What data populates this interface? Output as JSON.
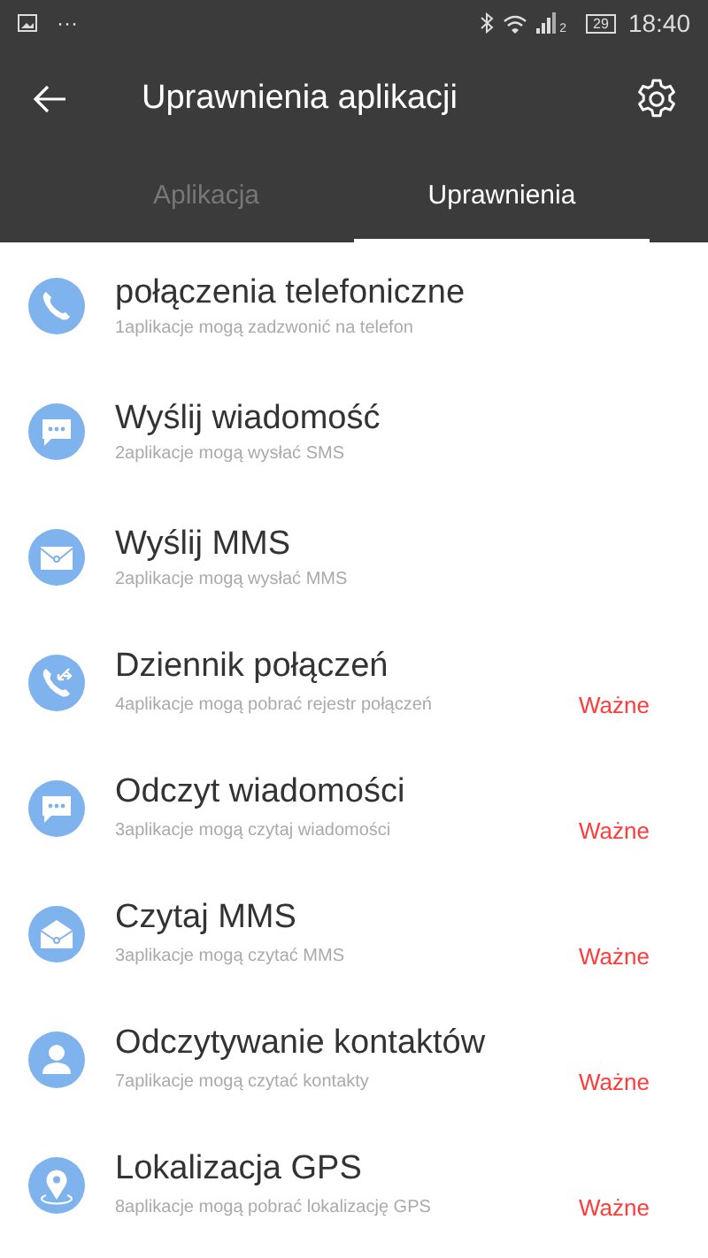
{
  "status_bar": {
    "dots": "···",
    "signal_sim": "2",
    "battery": "29",
    "time": "18:40"
  },
  "header": {
    "title": "Uprawnienia aplikacji"
  },
  "tabs": [
    {
      "label": "Aplikacja",
      "selected": false
    },
    {
      "label": "Uprawnienia",
      "selected": true
    }
  ],
  "permissions": [
    {
      "kind": "phone",
      "title": "połączenia telefoniczne",
      "subtitle": "1aplikacje mogą zadzwonić na telefon"
    },
    {
      "kind": "message",
      "title": "Wyślij wiadomość",
      "subtitle": "2aplikacje mogą wysłać SMS"
    },
    {
      "kind": "envelope",
      "title": "Wyślij MMS",
      "subtitle": "2aplikacje mogą wysłać MMS"
    },
    {
      "kind": "calllog",
      "title": "Dziennik połączeń",
      "subtitle": "4aplikacje mogą pobrać rejestr połączeń",
      "badge": "Ważne"
    },
    {
      "kind": "message",
      "title": "Odczyt wiadomości",
      "subtitle": "3aplikacje mogą czytaj wiadomości",
      "badge": "Ważne"
    },
    {
      "kind": "mail",
      "title": "Czytaj MMS",
      "subtitle": "3aplikacje mogą czytać MMS",
      "badge": "Ważne"
    },
    {
      "kind": "contact",
      "title": "Odczytywanie kontaktów",
      "subtitle": "7aplikacje mogą czytać kontakty",
      "badge": "Ważne"
    },
    {
      "kind": "location",
      "title": "Lokalizacja GPS",
      "subtitle": "8aplikacje mogą pobrać lokalizację GPS",
      "badge": "Ważne"
    }
  ]
}
